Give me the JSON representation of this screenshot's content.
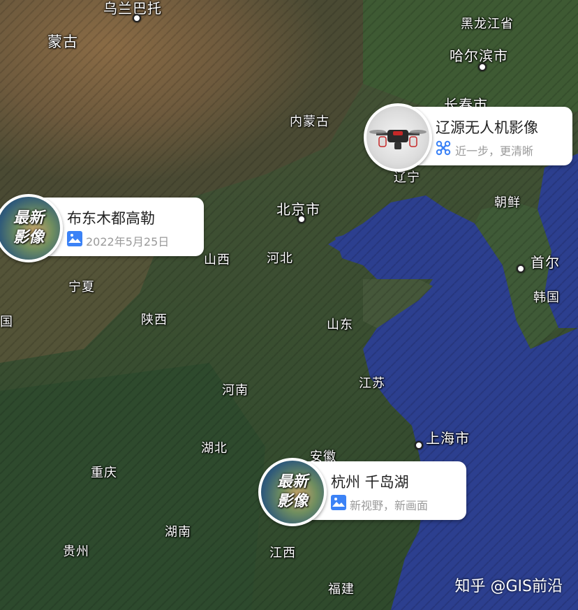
{
  "map": {
    "labels": {
      "wulanbatuo": "乌兰巴托",
      "mongolia": "蒙古",
      "heilongjiang": "黑龙江省",
      "harbin": "哈尔滨市",
      "changchun": "长春市",
      "neimenggu": "内蒙古",
      "liaoning": "辽宁",
      "beijing": "北京市",
      "chaoxian": "朝鲜",
      "shanxi": "山西",
      "hebei": "河北",
      "ningxia": "宁夏",
      "shouer": "首尔",
      "hanguo": "韩国",
      "shaanxi": "陕西",
      "shandong": "山东",
      "henan": "河南",
      "jiangsu": "江苏",
      "shanghai": "上海市",
      "hubei": "湖北",
      "anhui": "安徽",
      "chongqing": "重庆",
      "hunan": "湖南",
      "guizhou": "贵州",
      "jiangxi": "江西",
      "fujian": "福建",
      "edge_guo": "国"
    }
  },
  "cards": {
    "liaoyuan": {
      "title": "辽源无人机影像",
      "subtitle": "近一步，更清晰",
      "icon": "drone-icon"
    },
    "budongmu": {
      "title": "布东木都高勒",
      "subtitle": "2022年5月25日",
      "badge": "最新影像",
      "icon": "image-icon"
    },
    "hangzhou": {
      "title": "杭州 千岛湖",
      "subtitle": "新视野，新画面",
      "badge": "最新影像",
      "icon": "image-icon"
    }
  },
  "badge": {
    "line1": "最新",
    "line2": "影像"
  },
  "watermark": "知乎 @GIS前沿",
  "colors": {
    "accent_blue": "#3b82f6",
    "land": "#3d4a2e",
    "sea": "#2c3f8f"
  }
}
